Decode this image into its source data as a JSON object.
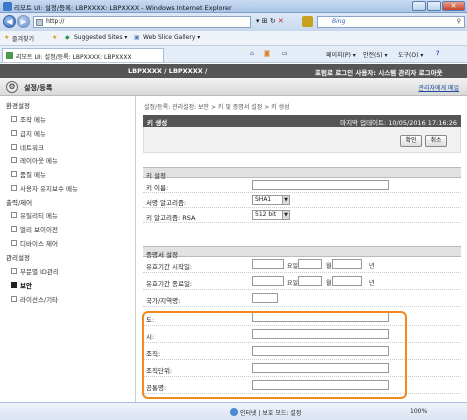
{
  "browser": {
    "window_title": "리모트 UI: 설정/등록: LBPXXXX: LBPXXXX - Windows Internet Explorer",
    "address": "http://",
    "search_placeholder": "Bing",
    "favorites_label": "즐겨찾기",
    "suggested_sites": "Suggested Sites ▾",
    "web_slice_gallery": "Web Slice Gallery ▾",
    "tab_title": "리모트 UI: 설정/등록: LBPXXXX: LBPXXXX",
    "toolbar": {
      "page": "페이지(P) ▾",
      "safety": "안전(S) ▾",
      "tools": "도구(O) ▾",
      "help": "?"
    },
    "status_zone": "인터넷 | 보호 모드: 설정",
    "zoom": "100%"
  },
  "app": {
    "device_name": "LBPXXXX / LBPXXXX /",
    "user_info": "포럼로 로그인 사용자: 시스템 관리자 로그아웃",
    "section_title": "설정/등록",
    "admin_mail_link": "관리자에게 메일"
  },
  "sidebar": {
    "groups": [
      {
        "label": "환경설정",
        "items": [
          {
            "label": "조작 메뉴"
          },
          {
            "label": "급지 메뉴"
          },
          {
            "label": "네트워크"
          },
          {
            "label": "레이아웃 메뉴"
          },
          {
            "label": "품질 메뉴"
          },
          {
            "label": "사용자 유지보수 메뉴"
          }
        ]
      },
      {
        "label": "출력/제어",
        "items": [
          {
            "label": "유틸리티 메뉴"
          },
          {
            "label": "멀리 보이이전"
          },
          {
            "label": "디바이스 제어"
          }
        ]
      },
      {
        "label": "관리설정",
        "items": [
          {
            "label": "부문별 ID관리"
          },
          {
            "label": "보안"
          },
          {
            "label": "라이선스/기타"
          }
        ]
      }
    ]
  },
  "main": {
    "breadcrumb": "설정/등록: 관리설정: 보안 > 키 및 증명서 설정 > 키 생성",
    "page_title": "키 생성",
    "last_updated": "마지막 업데이트: 10/05/2016 17:16:26",
    "ok_button": "확인",
    "cancel_button": "취소",
    "key_section": {
      "title": "키 설정",
      "key_name_label": "키 이름:",
      "sig_alg_label": "서명 알고리즘:",
      "sig_alg_value": "SHA1",
      "key_alg_label": "키 알고리즘: RSA",
      "key_len_value": "512 bit"
    },
    "cert_section": {
      "title": "증명서 설정",
      "start_label": "유효기간 시작일:",
      "end_label": "유효기간 종료일:",
      "unit_day": "요일",
      "unit_month": "월",
      "unit_year": "년",
      "country_label": "국가/지역명:",
      "state_label": "도:",
      "city_label": "시:",
      "org_label": "조직:",
      "orgunit_label": "조직단위:",
      "common_label": "공통명:"
    }
  }
}
